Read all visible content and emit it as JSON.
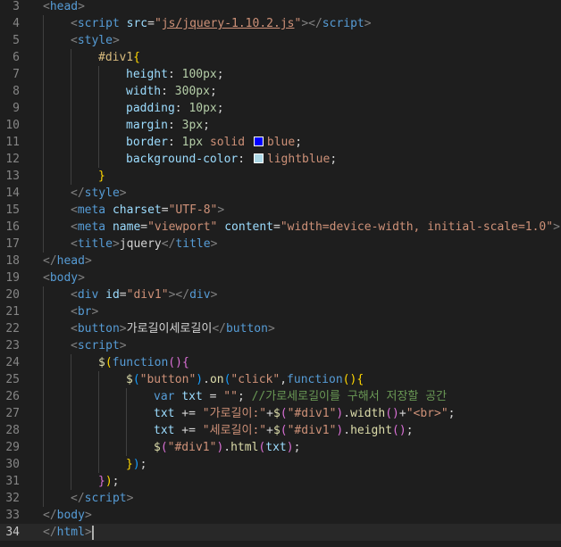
{
  "editor": {
    "language": "html",
    "current_line": 34,
    "lines": [
      {
        "n": "3",
        "indent": 0,
        "tokens": [
          [
            "b",
            "<"
          ],
          [
            "t",
            "head"
          ],
          [
            "b",
            ">"
          ]
        ]
      },
      {
        "n": "4",
        "indent": 1,
        "tokens": [
          [
            "b",
            "<"
          ],
          [
            "t",
            "script"
          ],
          [
            "x",
            " "
          ],
          [
            "a",
            "src"
          ],
          [
            "x",
            "="
          ],
          [
            "s",
            "\""
          ],
          [
            "su",
            "js/jquery-1.10.2.js"
          ],
          [
            "s",
            "\""
          ],
          [
            "b",
            "></"
          ],
          [
            "t",
            "script"
          ],
          [
            "b",
            ">"
          ]
        ]
      },
      {
        "n": "5",
        "indent": 1,
        "tokens": [
          [
            "b",
            "<"
          ],
          [
            "t",
            "style"
          ],
          [
            "b",
            ">"
          ]
        ]
      },
      {
        "n": "6",
        "indent": 2,
        "tokens": [
          [
            "sel",
            "#div1"
          ],
          [
            "p1",
            "{"
          ]
        ]
      },
      {
        "n": "7",
        "indent": 3,
        "tokens": [
          [
            "a",
            "height"
          ],
          [
            "x",
            ": "
          ],
          [
            "n",
            "100px"
          ],
          [
            "x",
            ";"
          ]
        ]
      },
      {
        "n": "8",
        "indent": 3,
        "tokens": [
          [
            "a",
            "width"
          ],
          [
            "x",
            ": "
          ],
          [
            "n",
            "300px"
          ],
          [
            "x",
            ";"
          ]
        ]
      },
      {
        "n": "9",
        "indent": 3,
        "tokens": [
          [
            "a",
            "padding"
          ],
          [
            "x",
            ": "
          ],
          [
            "n",
            "10px"
          ],
          [
            "x",
            ";"
          ]
        ]
      },
      {
        "n": "10",
        "indent": 3,
        "tokens": [
          [
            "a",
            "margin"
          ],
          [
            "x",
            ": "
          ],
          [
            "n",
            "3px"
          ],
          [
            "x",
            ";"
          ]
        ]
      },
      {
        "n": "11",
        "indent": 3,
        "tokens": [
          [
            "a",
            "border"
          ],
          [
            "x",
            ": "
          ],
          [
            "n",
            "1px"
          ],
          [
            "x",
            " "
          ],
          [
            "s",
            "solid"
          ],
          [
            "x",
            " "
          ],
          [
            "swatch",
            "#0000ff"
          ],
          [
            "s",
            "blue"
          ],
          [
            "x",
            ";"
          ]
        ]
      },
      {
        "n": "12",
        "indent": 3,
        "tokens": [
          [
            "a",
            "background-color"
          ],
          [
            "x",
            ": "
          ],
          [
            "swatch",
            "#add8e6"
          ],
          [
            "s",
            "lightblue"
          ],
          [
            "x",
            ";"
          ]
        ]
      },
      {
        "n": "13",
        "indent": 2,
        "tokens": [
          [
            "p1",
            "}"
          ]
        ]
      },
      {
        "n": "14",
        "indent": 1,
        "tokens": [
          [
            "b",
            "</"
          ],
          [
            "t",
            "style"
          ],
          [
            "b",
            ">"
          ]
        ]
      },
      {
        "n": "15",
        "indent": 1,
        "tokens": [
          [
            "b",
            "<"
          ],
          [
            "t",
            "meta"
          ],
          [
            "x",
            " "
          ],
          [
            "a",
            "charset"
          ],
          [
            "x",
            "="
          ],
          [
            "s",
            "\"UTF-8\""
          ],
          [
            "b",
            ">"
          ]
        ]
      },
      {
        "n": "16",
        "indent": 1,
        "tokens": [
          [
            "b",
            "<"
          ],
          [
            "t",
            "meta"
          ],
          [
            "x",
            " "
          ],
          [
            "a",
            "name"
          ],
          [
            "x",
            "="
          ],
          [
            "s",
            "\"viewport\""
          ],
          [
            "x",
            " "
          ],
          [
            "a",
            "content"
          ],
          [
            "x",
            "="
          ],
          [
            "s",
            "\"width=device-width, initial-scale=1.0\""
          ],
          [
            "b",
            ">"
          ]
        ]
      },
      {
        "n": "17",
        "indent": 1,
        "tokens": [
          [
            "b",
            "<"
          ],
          [
            "t",
            "title"
          ],
          [
            "b",
            ">"
          ],
          [
            "x",
            "jquery"
          ],
          [
            "b",
            "</"
          ],
          [
            "t",
            "title"
          ],
          [
            "b",
            ">"
          ]
        ]
      },
      {
        "n": "18",
        "indent": 0,
        "tokens": [
          [
            "b",
            "</"
          ],
          [
            "t",
            "head"
          ],
          [
            "b",
            ">"
          ]
        ]
      },
      {
        "n": "19",
        "indent": 0,
        "tokens": [
          [
            "b",
            "<"
          ],
          [
            "t",
            "body"
          ],
          [
            "b",
            ">"
          ]
        ]
      },
      {
        "n": "20",
        "indent": 1,
        "tokens": [
          [
            "b",
            "<"
          ],
          [
            "t",
            "div"
          ],
          [
            "x",
            " "
          ],
          [
            "a",
            "id"
          ],
          [
            "x",
            "="
          ],
          [
            "s",
            "\"div1\""
          ],
          [
            "b",
            "></"
          ],
          [
            "t",
            "div"
          ],
          [
            "b",
            ">"
          ]
        ]
      },
      {
        "n": "21",
        "indent": 1,
        "tokens": [
          [
            "b",
            "<"
          ],
          [
            "t",
            "br"
          ],
          [
            "b",
            ">"
          ]
        ]
      },
      {
        "n": "22",
        "indent": 1,
        "tokens": [
          [
            "b",
            "<"
          ],
          [
            "t",
            "button"
          ],
          [
            "b",
            ">"
          ],
          [
            "x",
            "가로길이세로길이"
          ],
          [
            "b",
            "</"
          ],
          [
            "t",
            "button"
          ],
          [
            "b",
            ">"
          ]
        ]
      },
      {
        "n": "23",
        "indent": 1,
        "tokens": [
          [
            "b",
            "<"
          ],
          [
            "t",
            "script"
          ],
          [
            "b",
            ">"
          ]
        ]
      },
      {
        "n": "24",
        "indent": 2,
        "tokens": [
          [
            "f",
            "$"
          ],
          [
            "p1",
            "("
          ],
          [
            "k",
            "function"
          ],
          [
            "p2",
            "()"
          ],
          [
            "p2",
            "{"
          ]
        ]
      },
      {
        "n": "25",
        "indent": 3,
        "tokens": [
          [
            "f",
            "$"
          ],
          [
            "p3",
            "("
          ],
          [
            "s",
            "\"button\""
          ],
          [
            "p3",
            ")"
          ],
          [
            "x",
            "."
          ],
          [
            "f",
            "on"
          ],
          [
            "p3",
            "("
          ],
          [
            "s",
            "\"click\""
          ],
          [
            "x",
            ","
          ],
          [
            "k",
            "function"
          ],
          [
            "p1",
            "()"
          ],
          [
            "p1",
            "{"
          ]
        ]
      },
      {
        "n": "26",
        "indent": 4,
        "tokens": [
          [
            "k",
            "var"
          ],
          [
            "x",
            " "
          ],
          [
            "a",
            "txt"
          ],
          [
            "x",
            " = "
          ],
          [
            "s",
            "\"\""
          ],
          [
            "x",
            "; "
          ],
          [
            "c",
            "//가로세로길이를 구해서 저장할 공간"
          ]
        ]
      },
      {
        "n": "27",
        "indent": 4,
        "tokens": [
          [
            "a",
            "txt"
          ],
          [
            "x",
            " += "
          ],
          [
            "s",
            "\"가로길이:\""
          ],
          [
            "x",
            "+"
          ],
          [
            "f",
            "$"
          ],
          [
            "p2",
            "("
          ],
          [
            "s",
            "\"#div1\""
          ],
          [
            "p2",
            ")"
          ],
          [
            "x",
            "."
          ],
          [
            "f",
            "width"
          ],
          [
            "p2",
            "()"
          ],
          [
            "x",
            "+"
          ],
          [
            "s",
            "\"<br>\""
          ],
          [
            "x",
            ";"
          ]
        ]
      },
      {
        "n": "28",
        "indent": 4,
        "tokens": [
          [
            "a",
            "txt"
          ],
          [
            "x",
            " += "
          ],
          [
            "s",
            "\"세로길이:\""
          ],
          [
            "x",
            "+"
          ],
          [
            "f",
            "$"
          ],
          [
            "p2",
            "("
          ],
          [
            "s",
            "\"#div1\""
          ],
          [
            "p2",
            ")"
          ],
          [
            "x",
            "."
          ],
          [
            "f",
            "height"
          ],
          [
            "p2",
            "()"
          ],
          [
            "x",
            ";"
          ]
        ]
      },
      {
        "n": "29",
        "indent": 4,
        "tokens": [
          [
            "f",
            "$"
          ],
          [
            "p2",
            "("
          ],
          [
            "s",
            "\"#div1\""
          ],
          [
            "p2",
            ")"
          ],
          [
            "x",
            "."
          ],
          [
            "f",
            "html"
          ],
          [
            "p2",
            "("
          ],
          [
            "a",
            "txt"
          ],
          [
            "p2",
            ")"
          ],
          [
            "x",
            ";"
          ]
        ]
      },
      {
        "n": "30",
        "indent": 3,
        "tokens": [
          [
            "p1",
            "}"
          ],
          [
            "p3",
            ")"
          ],
          [
            "x",
            ";"
          ]
        ]
      },
      {
        "n": "31",
        "indent": 2,
        "tokens": [
          [
            "p2",
            "}"
          ],
          [
            "p1",
            ")"
          ],
          [
            "x",
            ";"
          ]
        ]
      },
      {
        "n": "32",
        "indent": 1,
        "tokens": [
          [
            "b",
            "</"
          ],
          [
            "t",
            "script"
          ],
          [
            "b",
            ">"
          ]
        ]
      },
      {
        "n": "33",
        "indent": 0,
        "tokens": [
          [
            "b",
            "</"
          ],
          [
            "t",
            "body"
          ],
          [
            "b",
            ">"
          ]
        ]
      },
      {
        "n": "34",
        "indent": 0,
        "tokens": [
          [
            "b",
            "</"
          ],
          [
            "t",
            "html"
          ],
          [
            "b",
            ">"
          ],
          [
            "cursor",
            ""
          ]
        ]
      }
    ]
  }
}
